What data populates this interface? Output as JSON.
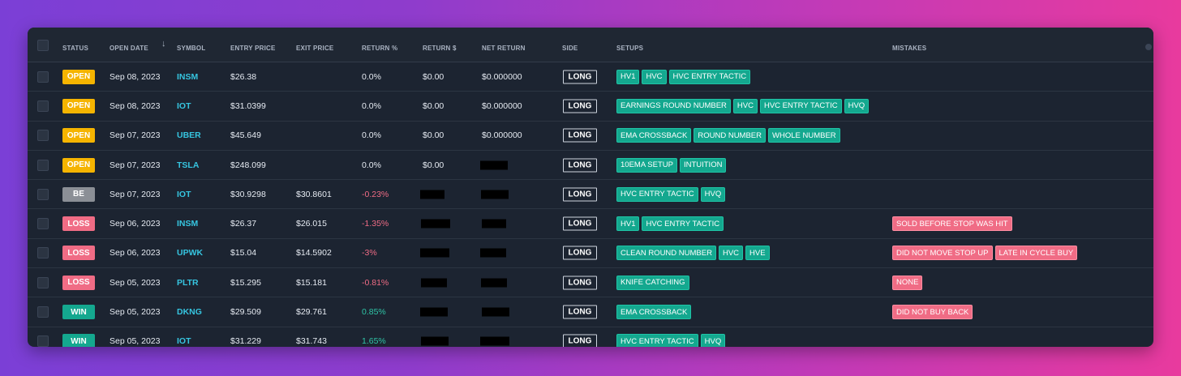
{
  "table": {
    "headers": {
      "status": "STATUS",
      "open_date": "OPEN DATE",
      "symbol": "SYMBOL",
      "entry_price": "ENTRY PRICE",
      "exit_price": "EXIT PRICE",
      "return_pct": "RETURN %",
      "return_usd": "RETURN $",
      "net_return": "NET RETURN",
      "side": "SIDE",
      "setups": "SETUPS",
      "mistakes": "MISTAKES"
    },
    "status_colors": {
      "OPEN": "#f5b400",
      "BE": "#8b8f96",
      "LOSS": "#f06c85",
      "WIN": "#14a88f"
    },
    "return_colors": {
      "neutral": "#e6ebf2",
      "negative": "#f06c85",
      "positive": "#2fc4a6"
    },
    "rows": [
      {
        "status": "OPEN",
        "date": "Sep 08, 2023",
        "symbol": "INSM",
        "entry": "$26.38",
        "exit": "",
        "ret_pct": "0.0%",
        "ret_sign": "neutral",
        "ret_usd": "$0.00",
        "net": "$0.000000",
        "side": "LONG",
        "setups": [
          "HV1",
          "HVC",
          "HVC ENTRY TACTIC"
        ],
        "mistakes": []
      },
      {
        "status": "OPEN",
        "date": "Sep 08, 2023",
        "symbol": "IOT",
        "entry": "$31.0399",
        "exit": "",
        "ret_pct": "0.0%",
        "ret_sign": "neutral",
        "ret_usd": "$0.00",
        "net": "$0.000000",
        "side": "LONG",
        "setups": [
          "EARNINGS ROUND NUMBER",
          "HVC",
          "HVC ENTRY TACTIC",
          "HVQ"
        ],
        "mistakes": []
      },
      {
        "status": "OPEN",
        "date": "Sep 07, 2023",
        "symbol": "UBER",
        "entry": "$45.649",
        "exit": "",
        "ret_pct": "0.0%",
        "ret_sign": "neutral",
        "ret_usd": "$0.00",
        "net": "$0.000000",
        "side": "LONG",
        "setups": [
          "EMA CROSSBACK",
          "ROUND NUMBER",
          "WHOLE NUMBER"
        ],
        "mistakes": []
      },
      {
        "status": "OPEN",
        "date": "Sep 07, 2023",
        "symbol": "TSLA",
        "entry": "$248.099",
        "exit": "",
        "ret_pct": "0.0%",
        "ret_sign": "neutral",
        "ret_usd": "$0.00",
        "net": null,
        "side": "LONG",
        "setups": [
          "10EMA SETUP",
          "INTUITION"
        ],
        "mistakes": []
      },
      {
        "status": "BE",
        "date": "Sep 07, 2023",
        "symbol": "IOT",
        "entry": "$30.9298",
        "exit": "$30.8601",
        "ret_pct": "-0.23%",
        "ret_sign": "negative",
        "ret_usd": null,
        "net": null,
        "side": "LONG",
        "setups": [
          "HVC ENTRY TACTIC",
          "HVQ"
        ],
        "mistakes": []
      },
      {
        "status": "LOSS",
        "date": "Sep 06, 2023",
        "symbol": "INSM",
        "entry": "$26.37",
        "exit": "$26.015",
        "ret_pct": "-1.35%",
        "ret_sign": "negative",
        "ret_usd": null,
        "net": null,
        "side": "LONG",
        "setups": [
          "HV1",
          "HVC ENTRY TACTIC"
        ],
        "mistakes": [
          "SOLD BEFORE STOP WAS HIT"
        ]
      },
      {
        "status": "LOSS",
        "date": "Sep 06, 2023",
        "symbol": "UPWK",
        "entry": "$15.04",
        "exit": "$14.5902",
        "ret_pct": "-3%",
        "ret_sign": "negative",
        "ret_usd": null,
        "net": null,
        "side": "LONG",
        "setups": [
          "CLEAN ROUND NUMBER",
          "HVC",
          "HVE"
        ],
        "mistakes": [
          "DID NOT MOVE STOP UP",
          "LATE IN CYCLE BUY"
        ]
      },
      {
        "status": "LOSS",
        "date": "Sep 05, 2023",
        "symbol": "PLTR",
        "entry": "$15.295",
        "exit": "$15.181",
        "ret_pct": "-0.81%",
        "ret_sign": "negative",
        "ret_usd": null,
        "net": null,
        "side": "LONG",
        "setups": [
          "KNIFE CATCHING"
        ],
        "mistakes": [
          "NONE"
        ]
      },
      {
        "status": "WIN",
        "date": "Sep 05, 2023",
        "symbol": "DKNG",
        "entry": "$29.509",
        "exit": "$29.761",
        "ret_pct": "0.85%",
        "ret_sign": "positive",
        "ret_usd": null,
        "net": null,
        "side": "LONG",
        "setups": [
          "EMA CROSSBACK"
        ],
        "mistakes": [
          "DID NOT BUY BACK"
        ]
      },
      {
        "status": "WIN",
        "date": "Sep 05, 2023",
        "symbol": "IOT",
        "entry": "$31.229",
        "exit": "$31.743",
        "ret_pct": "1.65%",
        "ret_sign": "positive",
        "ret_usd": null,
        "net": null,
        "side": "LONG",
        "setups": [
          "HVC ENTRY TACTIC",
          "HVQ"
        ],
        "mistakes": []
      }
    ]
  }
}
